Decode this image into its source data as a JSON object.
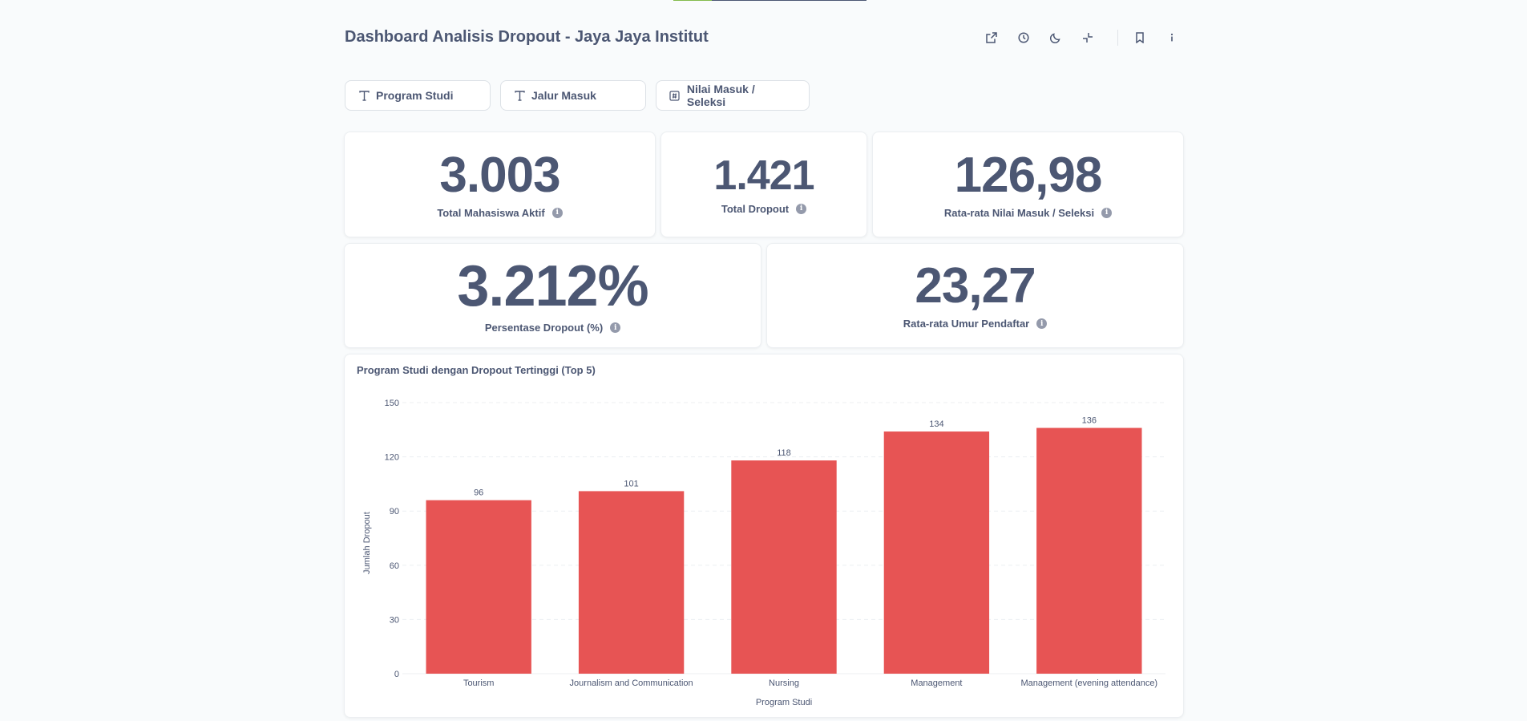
{
  "loading": {
    "progress_fraction": 0.2,
    "fill_color": "#84bb4c"
  },
  "dashboard": {
    "title": "Dashboard Analisis Dropout - Jaya Jaya Institut",
    "actions": [
      {
        "name": "sharing-icon"
      },
      {
        "name": "history-icon"
      },
      {
        "name": "night-mode-icon"
      },
      {
        "name": "fullscreen-exit-icon"
      },
      {
        "name": "bookmark-icon"
      },
      {
        "name": "info-icon"
      }
    ]
  },
  "filters": [
    {
      "label": "Program Studi",
      "icon": "text-icon"
    },
    {
      "label": "Jalur Masuk",
      "icon": "text-icon"
    },
    {
      "label": "Nilai Masuk / Seleksi",
      "icon": "number-icon"
    }
  ],
  "metrics": {
    "total_aktif": {
      "value": "3.003",
      "label": "Total Mahasiswa Aktif"
    },
    "total_dropout": {
      "value": "1.421",
      "label": "Total Dropout"
    },
    "rata_nilai": {
      "value": "126,98",
      "label": "Rata-rata Nilai Masuk / Seleksi"
    },
    "persen_dropout": {
      "value": "3.212%",
      "label": "Persentase Dropout (%)"
    },
    "rata_umur": {
      "value": "23,27",
      "label": "Rata-rata Umur Pendaftar"
    }
  },
  "chart_title": "Program Studi dengan Dropout Tertinggi (Top 5)",
  "chart_data": {
    "type": "bar",
    "categories": [
      "Tourism",
      "Journalism and Communication",
      "Nursing",
      "Management",
      "Management (evening attendance)"
    ],
    "values": [
      96,
      101,
      118,
      134,
      136
    ],
    "xlabel": "Program Studi",
    "ylabel": "Jumlah Dropout",
    "ylim": [
      0,
      150
    ],
    "yticks": [
      0,
      30,
      60,
      90,
      120,
      150
    ],
    "bar_color": "#e75454",
    "grid": true
  }
}
